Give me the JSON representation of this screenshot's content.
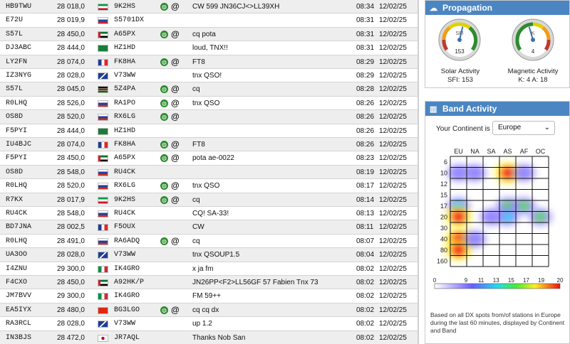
{
  "spots": [
    {
      "spotter": "HB9TWU",
      "freq": "28 018,0",
      "flag": "kw",
      "dx": "9K2HS",
      "qrz": true,
      "comment": "CW 599 JN36CJ<>LL39XH",
      "time": "08:34",
      "date": "12/02/25"
    },
    {
      "spotter": "E72U",
      "freq": "28 019,9",
      "flag": "si",
      "dx": "S5701DX",
      "qrz": false,
      "comment": "",
      "time": "08:31",
      "date": "12/02/25"
    },
    {
      "spotter": "S57L",
      "freq": "28 450,0",
      "flag": "ae",
      "dx": "A65PX",
      "qrz": true,
      "comment": "cq pota",
      "time": "08:31",
      "date": "12/02/25"
    },
    {
      "spotter": "DJ3ABC",
      "freq": "28 444,0",
      "flag": "sa",
      "dx": "HZ1HD",
      "qrz": false,
      "comment": "loud, TNX!!",
      "time": "08:31",
      "date": "12/02/25"
    },
    {
      "spotter": "LY2FN",
      "freq": "28 074,0",
      "flag": "fr",
      "dx": "FK8HA",
      "qrz": true,
      "comment": "FT8",
      "time": "08:29",
      "date": "12/02/25"
    },
    {
      "spotter": "IZ3NYG",
      "freq": "28 028,0",
      "flag": "un",
      "dx": "V73WW",
      "qrz": false,
      "comment": "tnx QSO!",
      "time": "08:29",
      "date": "12/02/25"
    },
    {
      "spotter": "S57L",
      "freq": "28 045,0",
      "flag": "ke",
      "dx": "5Z4PA",
      "qrz": true,
      "comment": "cq",
      "time": "08:28",
      "date": "12/02/25"
    },
    {
      "spotter": "R0LHQ",
      "freq": "28 526,0",
      "flag": "ru",
      "dx": "RA1PO",
      "qrz": true,
      "comment": "tnx QSO",
      "time": "08:26",
      "date": "12/02/25"
    },
    {
      "spotter": "OS8D",
      "freq": "28 520,0",
      "flag": "ru",
      "dx": "RX6LG",
      "qrz": true,
      "comment": "",
      "time": "08:26",
      "date": "12/02/25"
    },
    {
      "spotter": "F5PYI",
      "freq": "28 444,0",
      "flag": "sa",
      "dx": "HZ1HD",
      "qrz": false,
      "comment": "",
      "time": "08:26",
      "date": "12/02/25"
    },
    {
      "spotter": "IU4BJC",
      "freq": "28 074,0",
      "flag": "fr",
      "dx": "FK8HA",
      "qrz": true,
      "comment": "FT8",
      "time": "08:26",
      "date": "12/02/25"
    },
    {
      "spotter": "F5PYI",
      "freq": "28 450,0",
      "flag": "ae",
      "dx": "A65PX",
      "qrz": true,
      "comment": "pota ae-0022",
      "time": "08:23",
      "date": "12/02/25"
    },
    {
      "spotter": "OS8D",
      "freq": "28 548,0",
      "flag": "ru",
      "dx": "RU4CK",
      "qrz": false,
      "comment": "",
      "time": "08:19",
      "date": "12/02/25"
    },
    {
      "spotter": "R0LHQ",
      "freq": "28 520,0",
      "flag": "ru",
      "dx": "RX6LG",
      "qrz": true,
      "comment": "tnx QSO",
      "time": "08:17",
      "date": "12/02/25"
    },
    {
      "spotter": "R7KX",
      "freq": "28 017,9",
      "flag": "kw",
      "dx": "9K2HS",
      "qrz": true,
      "comment": "cq",
      "time": "08:14",
      "date": "12/02/25"
    },
    {
      "spotter": "RU4CK",
      "freq": "28 548,0",
      "flag": "ru",
      "dx": "RU4CK",
      "qrz": false,
      "comment": "CQ! SA-33!",
      "time": "08:13",
      "date": "12/02/25"
    },
    {
      "spotter": "BD7JNA",
      "freq": "28 002,5",
      "flag": "fr",
      "dx": "F5OUX",
      "qrz": false,
      "comment": "CW",
      "time": "08:11",
      "date": "12/02/25"
    },
    {
      "spotter": "R0LHQ",
      "freq": "28 491,0",
      "flag": "ru",
      "dx": "RA6ADQ",
      "qrz": true,
      "comment": "cq",
      "time": "08:07",
      "date": "12/02/25"
    },
    {
      "spotter": "UA3OO",
      "freq": "28 028,0",
      "flag": "un",
      "dx": "V73WW",
      "qrz": false,
      "comment": "tnx QSOUP1.5",
      "time": "08:04",
      "date": "12/02/25"
    },
    {
      "spotter": "I4ZNU",
      "freq": "29 300,0",
      "flag": "it",
      "dx": "IK4GRO",
      "qrz": false,
      "comment": "x ja fm",
      "time": "08:02",
      "date": "12/02/25"
    },
    {
      "spotter": "F4CXO",
      "freq": "28 450,0",
      "flag": "ae",
      "dx": "A92HK/P",
      "qrz": false,
      "comment": "JN26PP<F2>LL56GF 57 Fabien Tnx 73",
      "time": "08:02",
      "date": "12/02/25"
    },
    {
      "spotter": "JM7BVV",
      "freq": "29 300,0",
      "flag": "it",
      "dx": "IK4GRO",
      "qrz": false,
      "comment": "FM 59++",
      "time": "08:02",
      "date": "12/02/25"
    },
    {
      "spotter": "EA5IYX",
      "freq": "28 480,0",
      "flag": "cn",
      "dx": "BG3LGO",
      "qrz": true,
      "comment": "cq cq dx",
      "time": "08:02",
      "date": "12/02/25"
    },
    {
      "spotter": "RA3RCL",
      "freq": "28 028,0",
      "flag": "un",
      "dx": "V73WW",
      "qrz": false,
      "comment": "up 1.2",
      "time": "08:02",
      "date": "12/02/25"
    },
    {
      "spotter": "IN3BJS",
      "freq": "28 472,0",
      "flag": "jp",
      "dx": "JR7AQL",
      "qrz": false,
      "comment": "Thanks Nob San",
      "time": "08:02",
      "date": "12/02/25"
    }
  ],
  "propagation": {
    "title": "Propagation",
    "icon": "cloud-icon",
    "solar": {
      "gauge_label": "SFI",
      "value": "153",
      "level": 0.55,
      "caption": "Solar Activity",
      "sub": "SFI: 153"
    },
    "magnetic": {
      "gauge_label": "K",
      "value": "4",
      "level": 0.44,
      "caption": "Magnetic Activity",
      "sub": "K: 4   A: 18"
    }
  },
  "band_activity": {
    "title": "Band Activity",
    "icon": "chart-icon",
    "continent_label": "Your Continent is",
    "continent_value": "Europe",
    "columns": [
      "EU",
      "NA",
      "SA",
      "AS",
      "AF",
      "OC"
    ],
    "rows": [
      "6",
      "10",
      "12",
      "15",
      "17",
      "20",
      "30",
      "40",
      "80",
      "160"
    ],
    "heat": [
      {
        "col": 0,
        "row": 1,
        "v": 3
      },
      {
        "col": 3,
        "row": 1,
        "v": 20
      },
      {
        "col": 4,
        "row": 1,
        "v": 3
      },
      {
        "col": 1,
        "row": 1,
        "v": 2
      },
      {
        "col": 0,
        "row": 4,
        "v": 4
      },
      {
        "col": 3,
        "row": 4,
        "v": 8
      },
      {
        "col": 4,
        "row": 4,
        "v": 8
      },
      {
        "col": 5,
        "row": 5,
        "v": 7
      },
      {
        "col": 0,
        "row": 5,
        "v": 20
      },
      {
        "col": 3,
        "row": 5,
        "v": 4
      },
      {
        "col": 0,
        "row": 7,
        "v": 20
      },
      {
        "col": 0,
        "row": 8,
        "v": 20
      },
      {
        "col": 1,
        "row": 7,
        "v": 3
      },
      {
        "col": 2,
        "row": 5,
        "v": 2
      }
    ],
    "scale_ticks": [
      "0",
      "9",
      "11",
      "13",
      "15",
      "17",
      "19",
      "20"
    ],
    "note": "Based on all DX spots from/of stations in Europe during the last 60 minutes, displayed by Continent and Band"
  },
  "colors": {
    "header": "#4b86c2",
    "qrz": "#2a8a2a"
  }
}
